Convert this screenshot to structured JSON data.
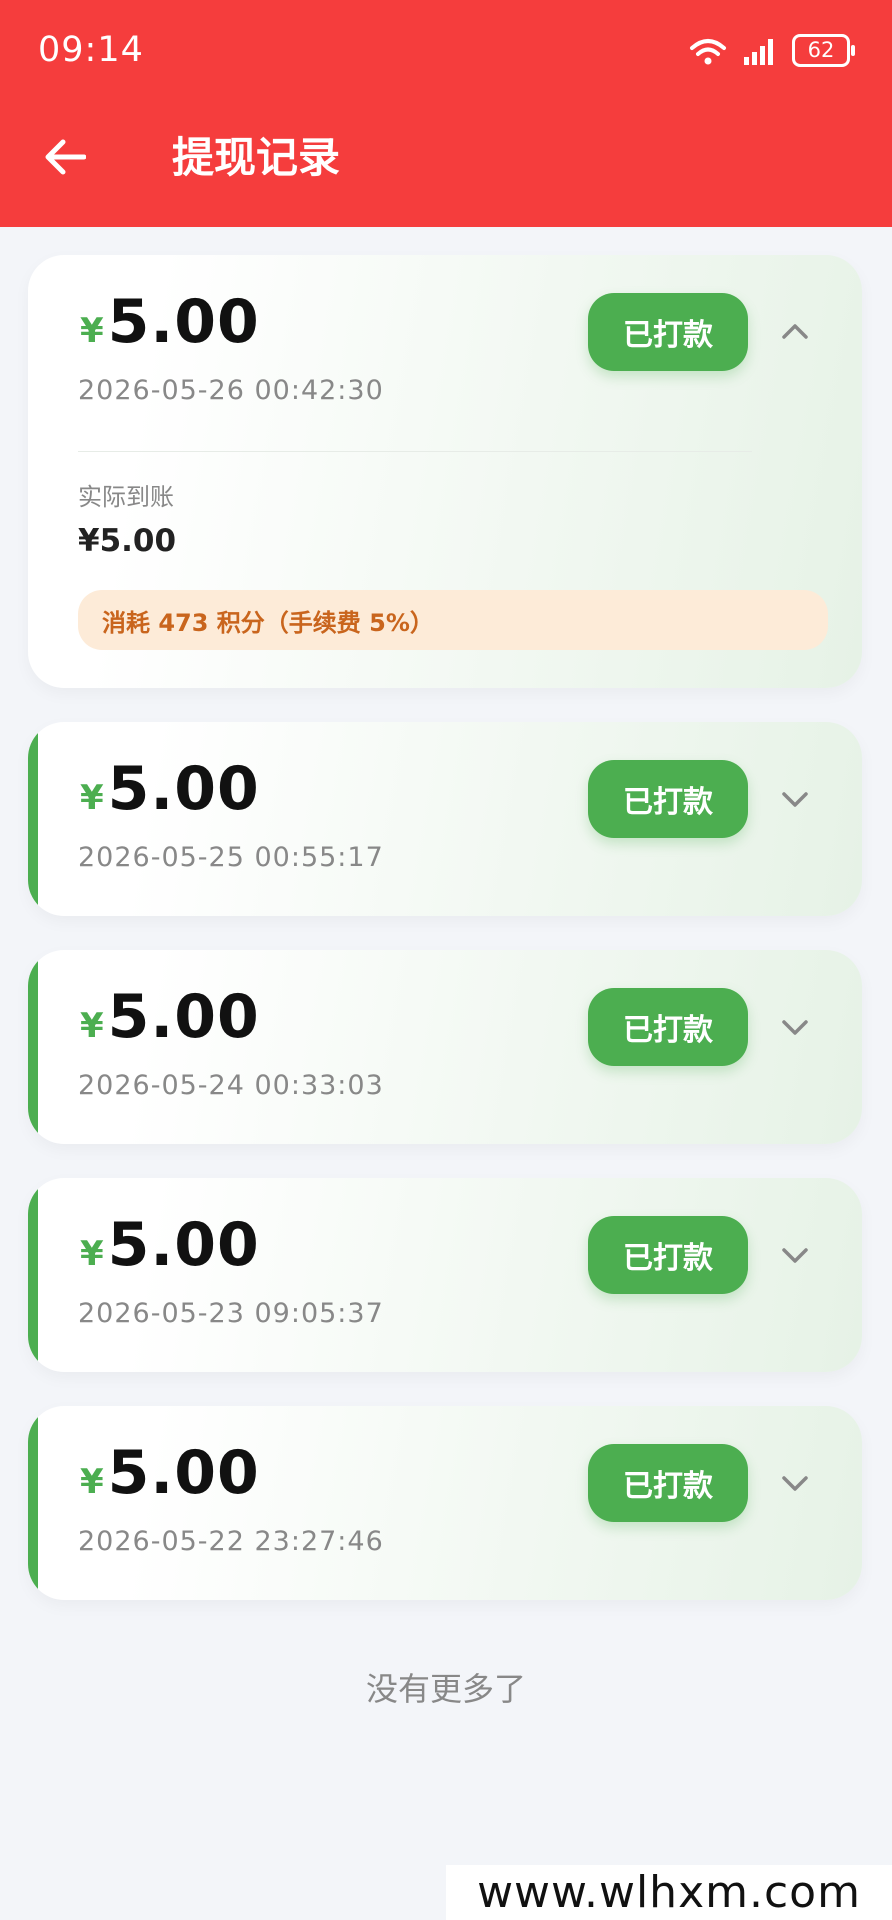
{
  "status_bar": {
    "time": "09:14",
    "battery": "62"
  },
  "header": {
    "title": "提现记录"
  },
  "records": [
    {
      "currency": "¥",
      "amount": "5.00",
      "date": "2026-05-26 00:42:30",
      "status": "已打款",
      "expanded": true,
      "detail_label": "实际到账",
      "detail_value": "¥5.00",
      "fee_note": "消耗 473 积分（手续费 5%）"
    },
    {
      "currency": "¥",
      "amount": "5.00",
      "date": "2026-05-25 00:55:17",
      "status": "已打款",
      "expanded": false
    },
    {
      "currency": "¥",
      "amount": "5.00",
      "date": "2026-05-24 00:33:03",
      "status": "已打款",
      "expanded": false
    },
    {
      "currency": "¥",
      "amount": "5.00",
      "date": "2026-05-23 09:05:37",
      "status": "已打款",
      "expanded": false
    },
    {
      "currency": "¥",
      "amount": "5.00",
      "date": "2026-05-22 23:27:46",
      "status": "已打款",
      "expanded": false
    }
  ],
  "footer": {
    "no_more": "没有更多了"
  },
  "watermark": "www.wlhxm.com",
  "colors": {
    "header": "#f53d3d",
    "accent_green": "#4cae50",
    "fee_text": "#c9651d",
    "fee_bg": "#fdebd8"
  },
  "icons": {
    "back": "arrow-left-icon",
    "expand": "chevron-down-icon",
    "collapse": "chevron-up-icon"
  }
}
